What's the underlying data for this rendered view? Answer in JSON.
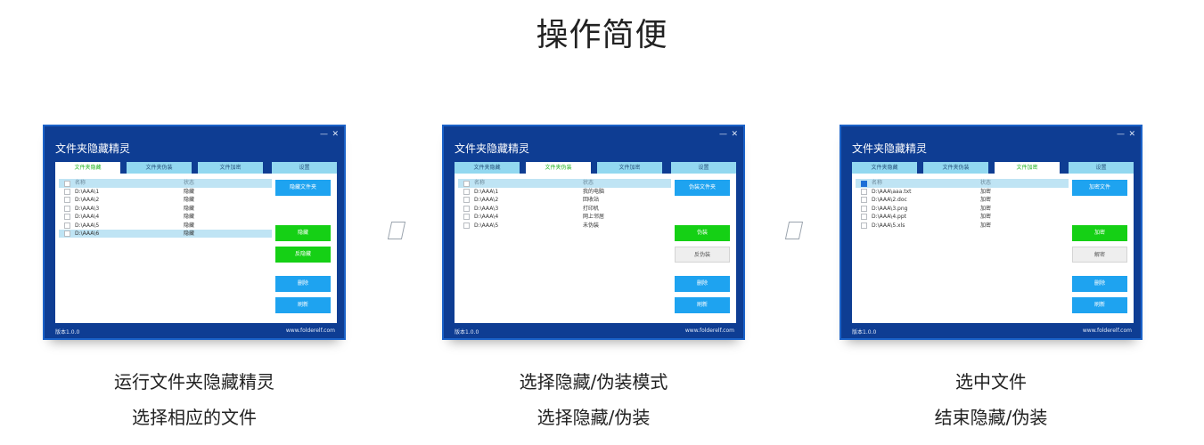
{
  "title": "操作简便",
  "app": {
    "window_title": "文件夹隐藏精灵",
    "min_glyph": "—",
    "close_glyph": "✕",
    "tabs": [
      "文件夹隐藏",
      "文件夹伪装",
      "文件加密",
      "设置"
    ],
    "col_name": "名称",
    "col_status": "状态",
    "version": "版本1.0.0",
    "website": "www.folderelf.com"
  },
  "steps": [
    {
      "active_tab": 0,
      "rows": [
        {
          "name": "D:\\AAA\\1",
          "status": "隐藏"
        },
        {
          "name": "D:\\AAA\\2",
          "status": "隐藏"
        },
        {
          "name": "D:\\AAA\\3",
          "status": "隐藏"
        },
        {
          "name": "D:\\AAA\\4",
          "status": "隐藏"
        },
        {
          "name": "D:\\AAA\\5",
          "status": "隐藏"
        },
        {
          "name": "D:\\AAA\\6",
          "status": "隐藏"
        }
      ],
      "selected_row": 5,
      "buttons": {
        "top": "隐藏文件夹",
        "primary": "隐藏",
        "secondary": "反隐藏",
        "delete": "删除",
        "refresh": "刷新"
      },
      "caption_line1": "运行文件夹隐藏精灵",
      "caption_line2": "选择相应的文件"
    },
    {
      "active_tab": 1,
      "rows": [
        {
          "name": "D:\\AAA\\1",
          "status": "我的电脑"
        },
        {
          "name": "D:\\AAA\\2",
          "status": "回收站"
        },
        {
          "name": "D:\\AAA\\3",
          "status": "打印机"
        },
        {
          "name": "D:\\AAA\\4",
          "status": "网上邻居"
        },
        {
          "name": "D:\\AAA\\5",
          "status": "未伪装"
        }
      ],
      "selected_row": null,
      "buttons": {
        "top": "伪装文件夹",
        "primary": "伪装",
        "secondary": "反伪装",
        "delete": "删除",
        "refresh": "刷新"
      },
      "caption_line1": "选择隐藏/伪装模式",
      "caption_line2": "选择隐藏/伪装"
    },
    {
      "active_tab": 2,
      "rows": [
        {
          "name": "D:\\AAA\\aaa.txt",
          "status": "加密"
        },
        {
          "name": "D:\\AAA\\2.doc",
          "status": "加密"
        },
        {
          "name": "D:\\AAA\\3.png",
          "status": "加密"
        },
        {
          "name": "D:\\AAA\\4.ppt",
          "status": "加密"
        },
        {
          "name": "D:\\AAA\\5.xls",
          "status": "加密"
        }
      ],
      "selected_row": null,
      "header_checked": true,
      "buttons": {
        "top": "加密文件",
        "primary": "加密",
        "secondary": "解密",
        "delete": "删除",
        "refresh": "刷新"
      },
      "caption_line1": "选中文件",
      "caption_line2": "结束隐藏/伪装"
    }
  ],
  "separator_glyph": "▯",
  "colors": {
    "window_bg": "#0e3d93",
    "tab_bg": "#92d8f0",
    "active_tab_text": "#22b322",
    "button_blue": "#1ea3f0",
    "button_green": "#15d015",
    "selected_row": "#bfe4f4"
  }
}
